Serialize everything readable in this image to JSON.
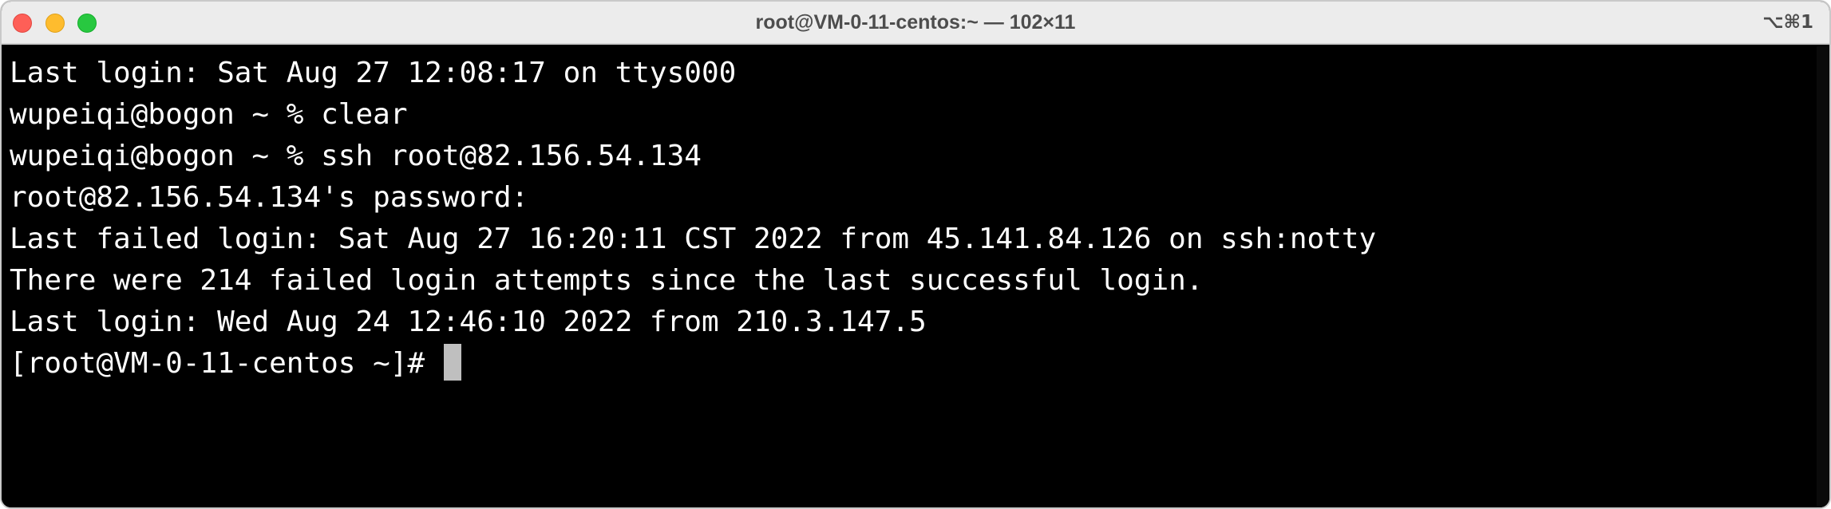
{
  "window": {
    "title": "root@VM-0-11-centos:~ — 102×11",
    "shortcut": "⌥⌘1"
  },
  "terminal": {
    "lines": [
      "Last login: Sat Aug 27 12:08:17 on ttys000",
      "wupeiqi@bogon ~ % clear",
      "wupeiqi@bogon ~ % ssh root@82.156.54.134",
      "root@82.156.54.134's password:",
      "Last failed login: Sat Aug 27 16:20:11 CST 2022 from 45.141.84.126 on ssh:notty",
      "There were 214 failed login attempts since the last successful login.",
      "Last login: Wed Aug 24 12:46:10 2022 from 210.3.147.5"
    ],
    "prompt": "[root@VM-0-11-centos ~]# "
  },
  "colors": {
    "close": "#fe5f57",
    "minimize": "#febc2e",
    "zoom": "#28c840",
    "terminal_bg": "#000000",
    "terminal_fg": "#ffffff",
    "cursor": "#bfbfbf"
  }
}
